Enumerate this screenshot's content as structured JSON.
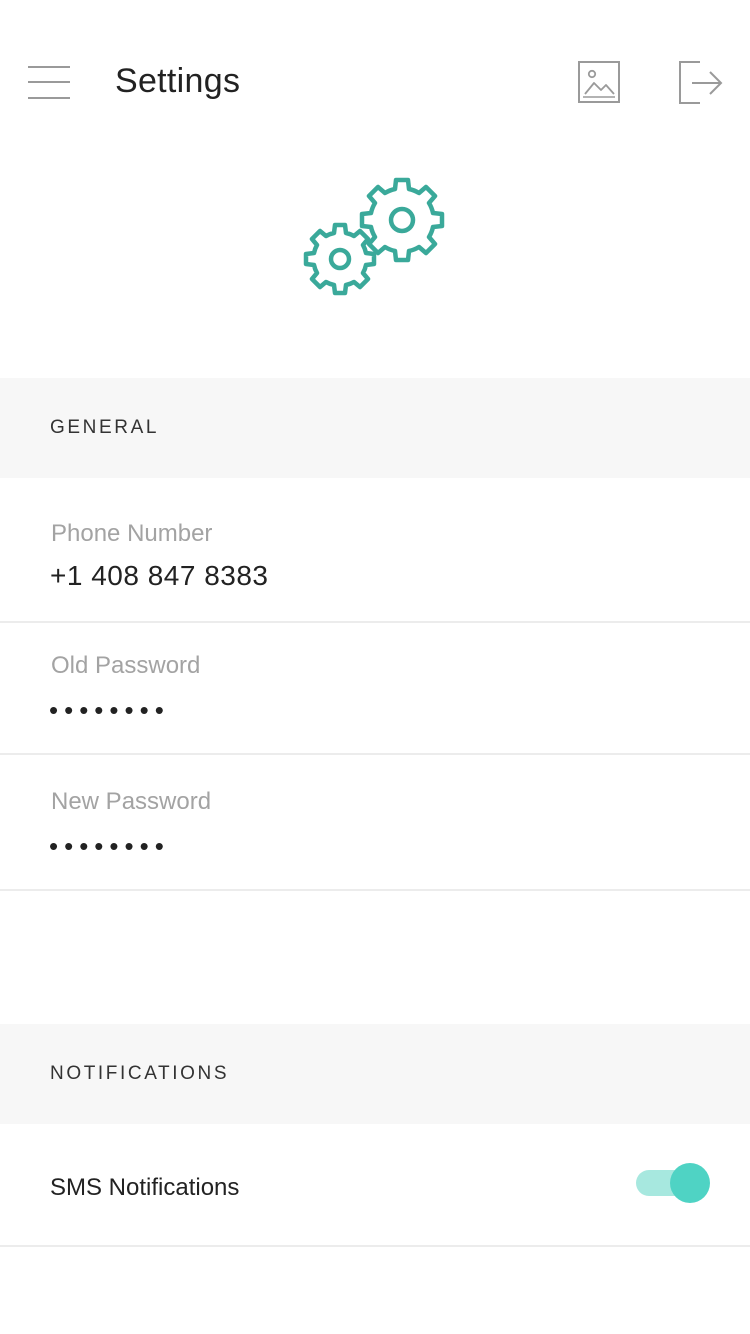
{
  "header": {
    "title": "Settings",
    "menu_icon": "menu-icon",
    "image_icon": "image-icon",
    "logout_icon": "logout-icon"
  },
  "illustration": {
    "icon": "gears-icon",
    "color": "#3aa99a"
  },
  "general": {
    "section_label": "GENERAL",
    "phone": {
      "label": "Phone Number",
      "value": "+1 408 847 8383"
    },
    "old_password": {
      "label": "Old Password",
      "value": "••••••••"
    },
    "new_password": {
      "label": "New Password",
      "value": "••••••••"
    }
  },
  "notifications": {
    "section_label": "NOTIFICATIONS",
    "sms": {
      "label": "SMS Notifications",
      "enabled": true
    }
  },
  "colors": {
    "accent": "#4fd3c4",
    "accent_light": "#a7e8df",
    "section_bg": "#f7f7f7",
    "label_gray": "#a3a3a3"
  }
}
